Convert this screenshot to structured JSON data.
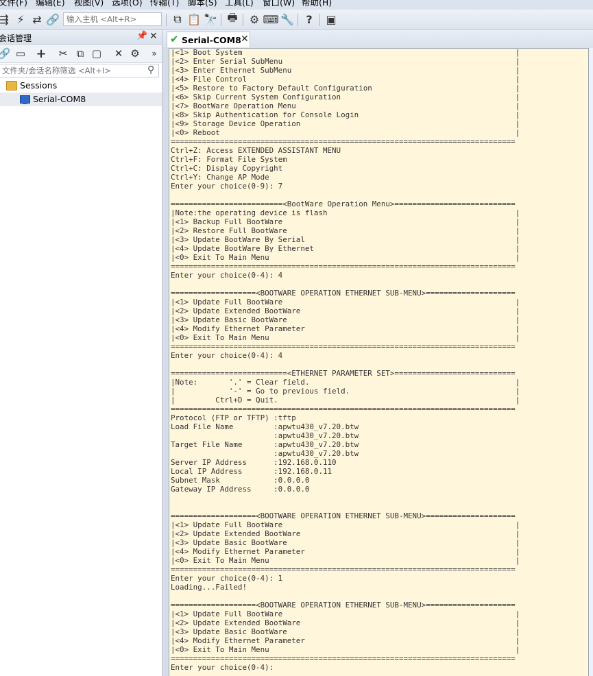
{
  "menubar": {
    "items": [
      "文件(F)",
      "编辑(E)",
      "视图(V)",
      "选项(O)",
      "传输(T)",
      "脚本(S)",
      "工具(L)",
      "窗口(W)",
      "帮助(H)"
    ]
  },
  "toolbar": {
    "host_placeholder": "输入主机 <Alt+R>",
    "icons": [
      "connect-icon",
      "lightning-icon",
      "reconnect-icon",
      "link-icon",
      "copy-icon",
      "paste-icon",
      "find-icon",
      "print-icon",
      "settings-icon",
      "keyboard-icon",
      "tool-icon",
      "help-icon",
      "screen-icon"
    ]
  },
  "sidebar": {
    "title": "会话管理",
    "filter_placeholder": "文件夹/会话名称筛选 <Alt+I>",
    "tree": {
      "root": "Sessions",
      "children": [
        "Serial-COM8"
      ]
    }
  },
  "tabs": [
    {
      "label": "Serial-COM8",
      "status": "connected"
    }
  ],
  "terminal": {
    "lines": [
      "|<1> Boot System                                                             |",
      "|<2> Enter Serial SubMenu                                                    |",
      "|<3> Enter Ethernet SubMenu                                                  |",
      "|<4> File Control                                                            |",
      "|<5> Restore to Factory Default Configuration                                |",
      "|<6> Skip Current System Configuration                                       |",
      "|<7> BootWare Operation Menu                                                 |",
      "|<8> Skip Authentication for Console Login                                   |",
      "|<9> Storage Device Operation                                                |",
      "|<0> Reboot                                                                  |",
      "=============================================================================",
      "Ctrl+Z: Access EXTENDED ASSISTANT MENU",
      "Ctrl+F: Format File System",
      "Ctrl+C: Display Copyright",
      "Ctrl+Y: Change AP Mode",
      "Enter your choice(0-9): 7",
      "",
      "=========================<BootWare Operation Menu>===========================",
      "|Note:the operating device is flash                                          |",
      "|<1> Backup Full BootWare                                                    |",
      "|<2> Restore Full BootWare                                                   |",
      "|<3> Update BootWare By Serial                                               |",
      "|<4> Update BootWare By Ethernet                                             |",
      "|<0> Exit To Main Menu                                                       |",
      "=============================================================================",
      "Enter your choice(0-4): 4",
      "",
      "===================<BOOTWARE OPERATION ETHERNET SUB-MENU>====================",
      "|<1> Update Full BootWare                                                    |",
      "|<2> Update Extended BootWare                                                |",
      "|<3> Update Basic BootWare                                                   |",
      "|<4> Modify Ethernet Parameter                                               |",
      "|<0> Exit To Main Menu                                                       |",
      "=============================================================================",
      "Enter your choice(0-4): 4",
      "",
      "==========================<ETHERNET PARAMETER SET>===========================",
      "|Note:       '.' = Clear field.                                              |",
      "|            '-' = Go to previous field.                                     |",
      "|         Ctrl+D = Quit.                                                     |",
      "=============================================================================",
      "Protocol (FTP or TFTP) :tftp",
      "Load File Name         :apwtu430_v7.20.btw",
      "                       :apwtu430_v7.20.btw",
      "Target File Name       :apwtu430_v7.20.btw",
      "                       :apwtu430_v7.20.btw",
      "Server IP Address      :192.168.0.110",
      "Local IP Address       :192.168.0.11",
      "Subnet Mask            :0.0.0.0",
      "Gateway IP Address     :0.0.0.0",
      "",
      "",
      "===================<BOOTWARE OPERATION ETHERNET SUB-MENU>====================",
      "|<1> Update Full BootWare                                                    |",
      "|<2> Update Extended BootWare                                                |",
      "|<3> Update Basic BootWare                                                   |",
      "|<4> Modify Ethernet Parameter                                               |",
      "|<0> Exit To Main Menu                                                       |",
      "=============================================================================",
      "Enter your choice(0-4): 1",
      "Loading...Failed!",
      "",
      "===================<BOOTWARE OPERATION ETHERNET SUB-MENU>====================",
      "|<1> Update Full BootWare                                                    |",
      "|<2> Update Extended BootWare                                                |",
      "|<3> Update Basic BootWare                                                   |",
      "|<4> Modify Ethernet Parameter                                               |",
      "|<0> Exit To Main Menu                                                       |",
      "=============================================================================",
      "Enter your choice(0-4):"
    ]
  }
}
